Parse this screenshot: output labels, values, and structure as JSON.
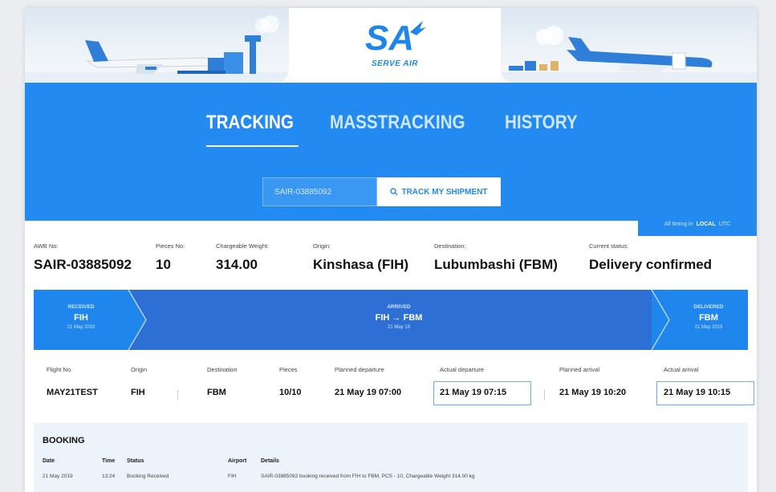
{
  "brand": {
    "logo_mark": "SA",
    "name": "SERVE AIR"
  },
  "nav": {
    "tabs": [
      "TRACKING",
      "MASSTRACKING",
      "HISTORY"
    ],
    "active_tab": "TRACKING"
  },
  "search": {
    "value": "SAIR-03885092",
    "button_label": "TRACK MY SHIPMENT"
  },
  "timezone": {
    "label": "All timing in",
    "options": [
      "LOCAL",
      "UTC"
    ],
    "selected": "LOCAL"
  },
  "summary": {
    "awb": {
      "label": "AWB No:",
      "value": "SAIR-03885092"
    },
    "pieces": {
      "label": "Pieces No:",
      "value": "10"
    },
    "weight": {
      "label": "Chargeable Weight:",
      "value": "314.00"
    },
    "origin": {
      "label": "Origin:",
      "value": "Kinshasa (FIH)"
    },
    "destination": {
      "label": "Destination:",
      "value": "Lubumbashi (FBM)"
    },
    "status": {
      "label": "Current status:",
      "value": "Delivery confirmed"
    }
  },
  "progress": {
    "steps": [
      {
        "status": "RECEIVED",
        "place": "FIH",
        "date": "21 May 2019"
      },
      {
        "status": "ARRIVED",
        "place": "FIH → FBM",
        "date": "21 May 19"
      },
      {
        "status": "DELIVERED",
        "place": "FBM",
        "date": "21 May 2019"
      }
    ]
  },
  "flight": {
    "headers": [
      "Flight No.",
      "Origin",
      "Destination",
      "Pieces",
      "Planned departure",
      "Actual departure",
      "Planned arrival",
      "Actual arrival"
    ],
    "values": [
      "MAY21TEST",
      "FIH",
      "FBM",
      "10/10",
      "21 May 19 07:00",
      "21 May 19 07:15",
      "21 May 19 10:20",
      "21 May 19 10:15"
    ]
  },
  "booking": {
    "title": "BOOKING",
    "headers": [
      "Date",
      "Time",
      "Status",
      "Airport",
      "Details"
    ],
    "rows": [
      [
        "21 May 2019",
        "13:24",
        "Booking Received",
        "FIH",
        "SAIR-03885092 booking received from FIH to FBM, PCS - 10, Chargeable Weight 314.00 kg"
      ]
    ]
  },
  "colors": {
    "primary": "#228af0",
    "booking_bg": "#edf3fa"
  }
}
